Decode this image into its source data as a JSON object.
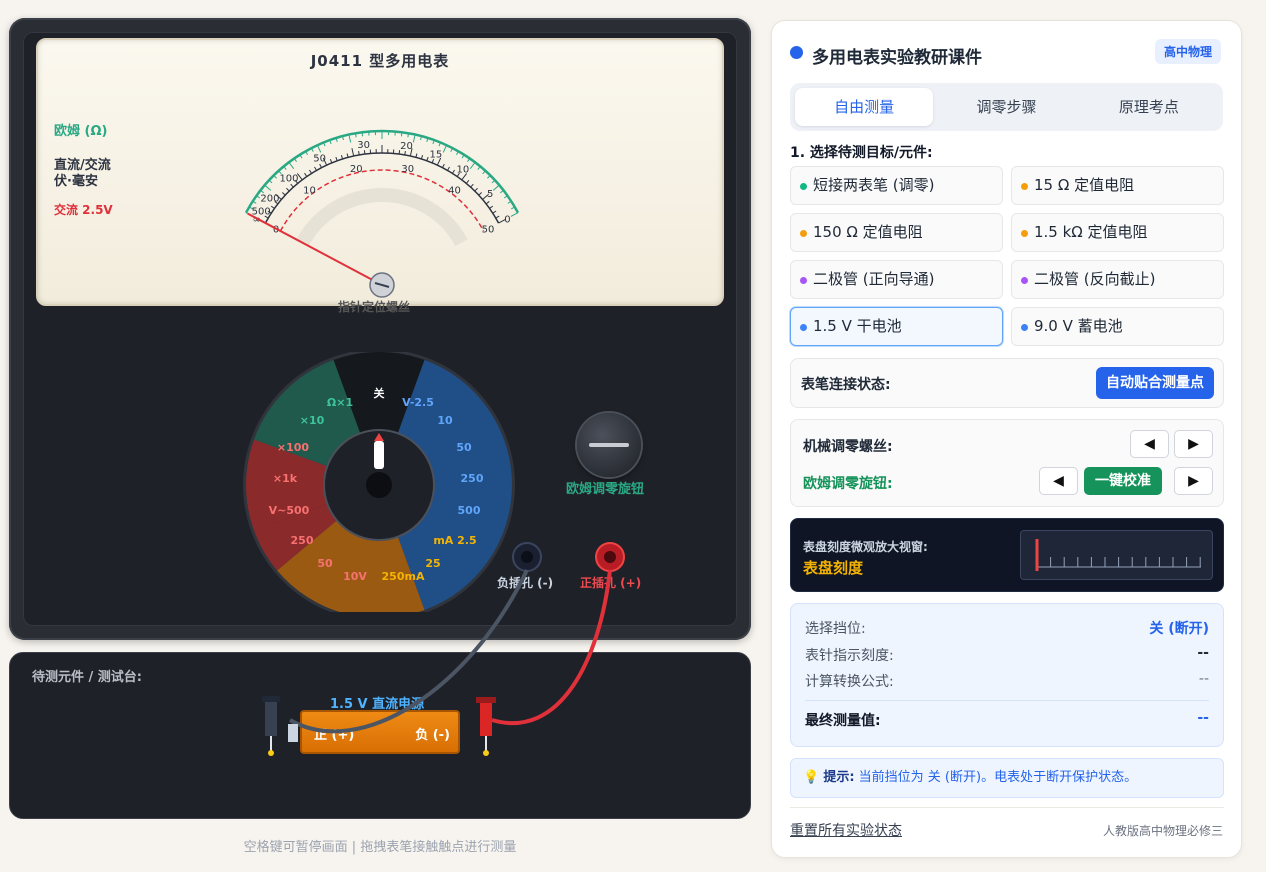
{
  "meter": {
    "model": "J0411 型多用电表",
    "scale_ohm": "欧姆 (Ω)",
    "scale_dc_line1": "直流/交流",
    "scale_dc_line2": "伏·毫安",
    "scale_ac": "交流 2.5V",
    "ohm_ticks": [
      "0",
      "5",
      "10",
      "15",
      "20",
      "30",
      "50",
      "100",
      "200",
      "500",
      "∞"
    ],
    "dc_ticks": [
      "0",
      "10",
      "20",
      "30",
      "40",
      "50"
    ],
    "screw_label": "指针定位螺丝",
    "selector": {
      "off": "关",
      "ohm": [
        "Ω×1",
        "×10",
        "×100",
        "×1k"
      ],
      "acv": "V~500",
      "dcv_label": "V-2.5",
      "dcv": [
        "10",
        "50",
        "250",
        "500"
      ],
      "ma": [
        "mA 2.5",
        "25",
        "250mA"
      ],
      "orange": [
        "250",
        "50",
        "10V"
      ],
      "pointer_position": "关"
    },
    "neg_jack": "负插孔 (-)",
    "pos_jack": "正插孔 (+)",
    "ohm_knob": "欧姆调零旋钮"
  },
  "bench": {
    "title": "待测元件 / 测试台:",
    "source": "1.5 V 直流电源",
    "battery_pos": "正 (+)",
    "battery_neg": "负 (-)"
  },
  "footer_hint": "空格键可暂停画面 | 拖拽表笔接触触点进行测量",
  "panel": {
    "title": "多用电表实验教研课件",
    "badge": "高中物理",
    "tabs": [
      "自由测量",
      "调零步骤",
      "原理考点"
    ],
    "active_tab": "自由测量",
    "select_label": "1. 选择待测目标/元件:",
    "targets": [
      {
        "label": "短接两表笔 (调零)",
        "color": "#10b981"
      },
      {
        "label": "15 Ω 定值电阻",
        "color": "#f59e0b"
      },
      {
        "label": "150 Ω 定值电阻",
        "color": "#f59e0b"
      },
      {
        "label": "1.5 kΩ 定值电阻",
        "color": "#f59e0b"
      },
      {
        "label": "二极管 (正向导通)",
        "color": "#a855f7"
      },
      {
        "label": "二极管 (反向截止)",
        "color": "#a855f7"
      },
      {
        "label": "1.5 V 干电池",
        "color": "#3b82f6"
      },
      {
        "label": "9.0 V 蓄电池",
        "color": "#3b82f6"
      }
    ],
    "selected_target": "1.5 V 干电池",
    "probe_status_label": "表笔连接状态:",
    "auto_snap_button": "自动贴合测量点",
    "mech_zero_label": "机械调零螺丝:",
    "ohm_zero_label": "欧姆调零旋钮:",
    "calibrate_button": "一键校准",
    "left_arrow": "◀",
    "right_arrow": "▶",
    "zoom_sub": "表盘刻度微观放大视窗:",
    "zoom_main": "表盘刻度",
    "readout": {
      "range_label": "选择挡位:",
      "range_value": "关 (断开)",
      "pointer_label": "表针指示刻度:",
      "pointer_value": "--",
      "formula_label": "计算转换公式:",
      "formula_value": "--",
      "final_label": "最终测量值:",
      "final_value": "--"
    },
    "tip_label": "提示:",
    "tip_text": "当前挡位为 关 (断开)。电表处于断开保护状态。",
    "reset_link": "重置所有实验状态",
    "footer": "人教版高中物理必修三"
  },
  "colors": {
    "accent": "#2563eb",
    "ohm_green": "#2aa884",
    "ac_red": "#e0313b",
    "battery": "#e67e0a"
  }
}
